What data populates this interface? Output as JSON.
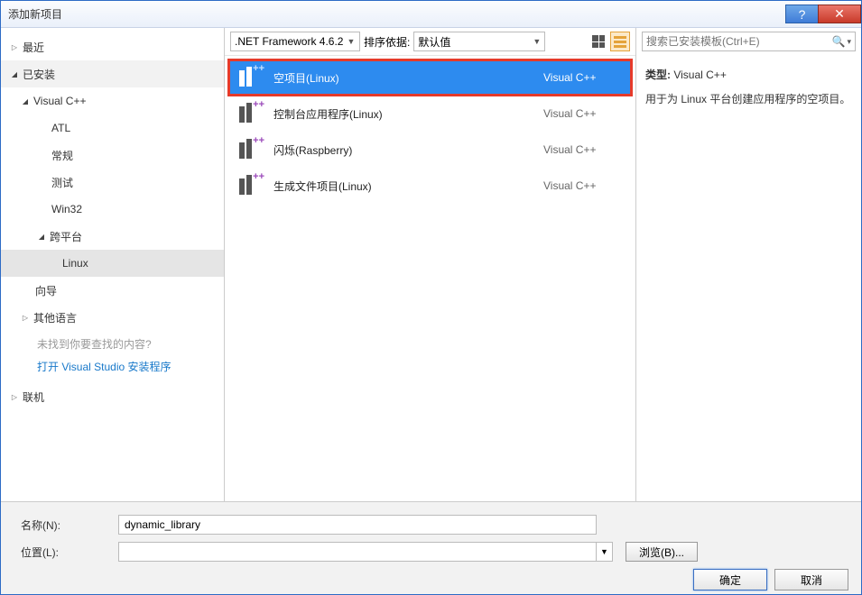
{
  "window": {
    "title": "添加新项目"
  },
  "tree": {
    "recent": "最近",
    "installed": "已安装",
    "vc": "Visual C++",
    "atl": "ATL",
    "general": "常规",
    "test": "测试",
    "win32": "Win32",
    "crossplatform": "跨平台",
    "linux": "Linux",
    "wizard": "向导",
    "otherlang": "其他语言",
    "online": "联机",
    "help": "未找到你要查找的内容?",
    "link": "打开 Visual Studio 安装程序"
  },
  "toolbar": {
    "framework": ".NET Framework 4.6.2",
    "sortlabel": "排序依据:",
    "sortvalue": "默认值"
  },
  "templates": {
    "t1": {
      "name": "空项目(Linux)",
      "type": "Visual C++"
    },
    "t2": {
      "name": "控制台应用程序(Linux)",
      "type": "Visual C++"
    },
    "t3": {
      "name": "闪烁(Raspberry)",
      "type": "Visual C++"
    },
    "t4": {
      "name": "生成文件项目(Linux)",
      "type": "Visual C++"
    }
  },
  "search": {
    "placeholder": "搜索已安装模板(Ctrl+E)"
  },
  "details": {
    "typelabel": "类型:",
    "typevalue": "Visual C++",
    "desc": "用于为 Linux 平台创建应用程序的空项目。"
  },
  "form": {
    "namelabel": "名称(N):",
    "namevalue": "dynamic_library",
    "loclabel": "位置(L):",
    "locvalue": "",
    "browse": "浏览(B)...",
    "ok": "确定",
    "cancel": "取消"
  }
}
